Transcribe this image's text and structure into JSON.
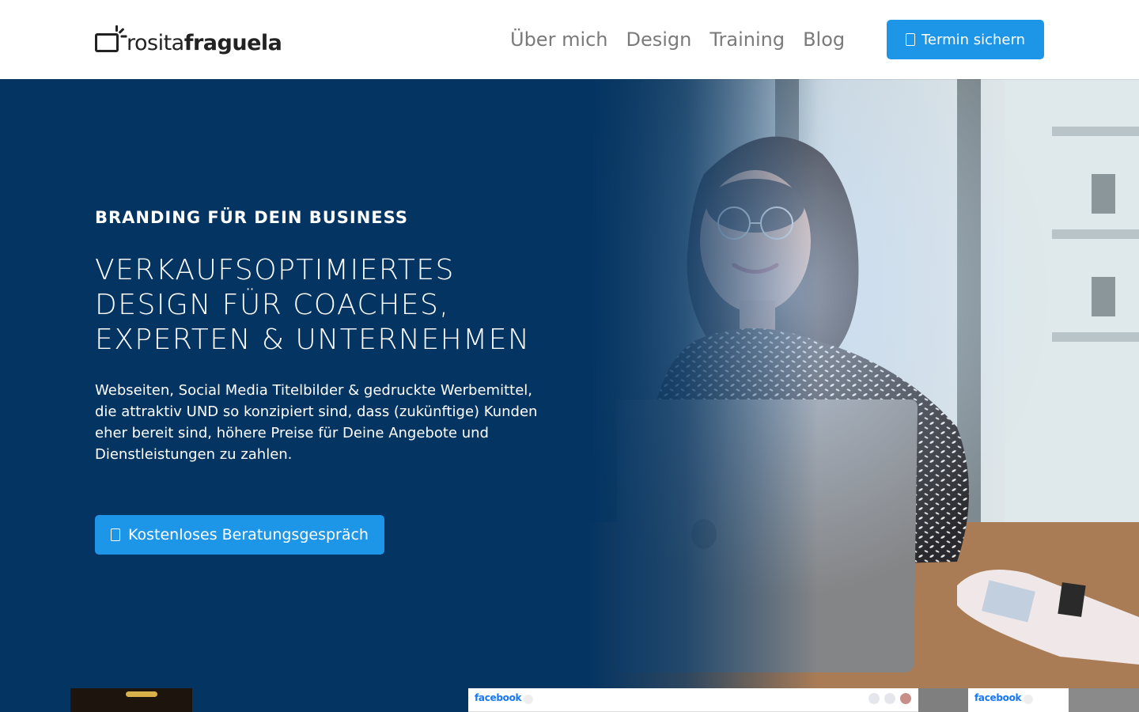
{
  "header": {
    "logo": {
      "text_light": "rosita",
      "text_bold": "fraguela"
    },
    "nav": [
      {
        "label": "Über mich"
      },
      {
        "label": "Design"
      },
      {
        "label": "Training"
      },
      {
        "label": "Blog"
      }
    ],
    "cta_label": "Termin sichern",
    "cta_icon": "calendar-icon"
  },
  "hero": {
    "kicker": "BRANDING FÜR DEIN BUSINESS",
    "headline_lines": [
      "VERKAUFSOPTIMIERTES",
      "DESIGN FÜR COACHES,",
      "EXPERTEN & UNTERNEHMEN"
    ],
    "lead": "Webseiten, Social Media Titelbilder & gedruckte Werbemittel, die attraktiv UND so konzipiert sind, dass (zukünftige) Kunden eher bereit sind, höhere Preise für Deine Angebote und Dienstleistungen zu zahlen.",
    "cta_label": "Kostenloses Beratungsgespräch",
    "cta_icon": "calendar-icon"
  },
  "strip": {
    "facebook_label_1": "facebook",
    "facebook_label_2": "facebook"
  },
  "colors": {
    "hero_bg": "#033462",
    "accent": "#1e96e8",
    "nav_text": "#7a7a7a"
  }
}
